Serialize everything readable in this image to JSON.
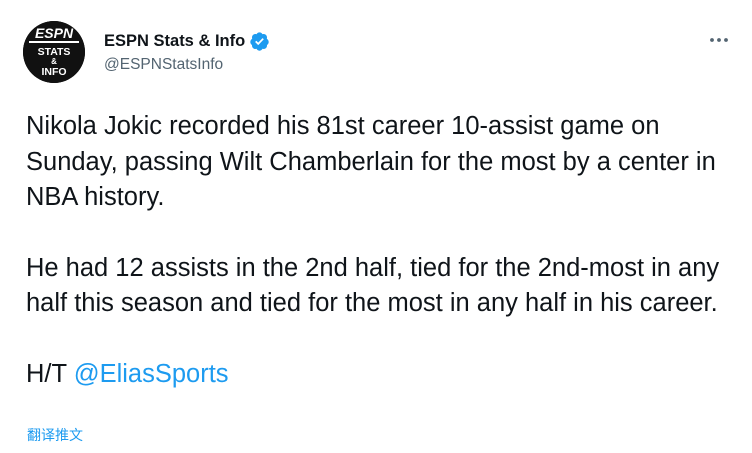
{
  "tweet": {
    "author": {
      "display_name": "ESPN Stats & Info",
      "handle": "@ESPNStatsInfo",
      "verified": true,
      "avatar_logo_text": [
        "ESPN",
        "STATS",
        "&",
        "INFO"
      ]
    },
    "body": {
      "paragraph1": "Nikola Jokic recorded his 81st career 10-assist game on Sunday, passing Wilt Chamberlain for the most by a center in NBA history.",
      "paragraph2": "He had 12 assists in the 2nd half, tied for the 2nd-most in any half this season and tied for the most in any half in his career.",
      "ht_prefix": "H/T ",
      "ht_mention": "@EliasSports"
    },
    "translate_label": "翻译推文",
    "more_icon": "more-horizontal-icon",
    "colors": {
      "link": "#1d9bf0",
      "verified": "#1d9bf0",
      "secondary_text": "#536471",
      "primary_text": "#0f1419"
    }
  }
}
